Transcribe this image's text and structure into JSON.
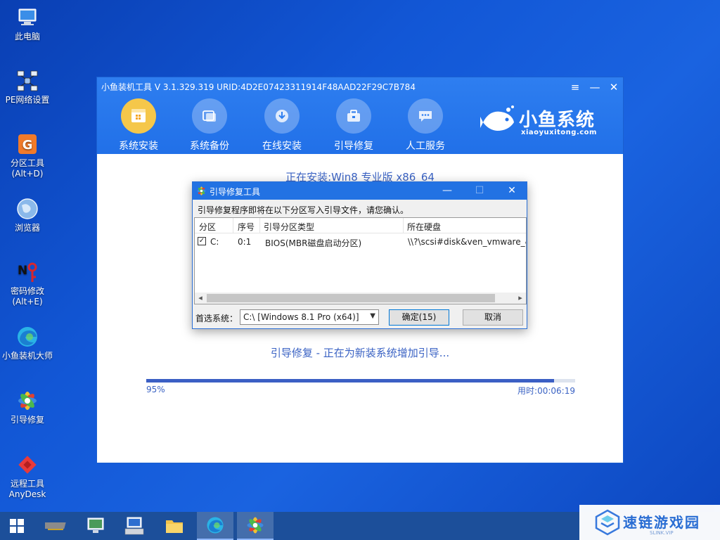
{
  "desktop": {
    "icons": [
      {
        "label": "此电脑",
        "icon": "computer-icon"
      },
      {
        "label": "PE网络设置",
        "icon": "network-icon"
      },
      {
        "label": "分区工具",
        "sub": "(Alt+D)",
        "icon": "partition-icon"
      },
      {
        "label": "浏览器",
        "icon": "browser-icon"
      },
      {
        "label": "密码修改",
        "sub": "(Alt+E)",
        "icon": "password-icon"
      },
      {
        "label": "小鱼装机大师",
        "icon": "edge-icon"
      },
      {
        "label": "引导修复",
        "icon": "boot-repair-icon"
      },
      {
        "label": "远程工具",
        "sub": "AnyDesk",
        "icon": "anydesk-icon"
      }
    ]
  },
  "app": {
    "title": "小鱼装机工具 V 3.1.329.319 URID:4D2E07423311914F48AAD22F29C7B784",
    "nav": [
      {
        "label": "系统安装",
        "icon": "install-icon",
        "active": true
      },
      {
        "label": "系统备份",
        "icon": "backup-icon",
        "active": false
      },
      {
        "label": "在线安装",
        "icon": "download-icon",
        "active": false
      },
      {
        "label": "引导修复",
        "icon": "toolbox-icon",
        "active": false
      },
      {
        "label": "人工服务",
        "icon": "chat-icon",
        "active": false
      }
    ],
    "brand_title": "小鱼系统",
    "brand_sub": "xiaoyuxitong.com",
    "installing": "正在安装:Win8 专业版 x86_64",
    "status": "引导修复 - 正在为新装系统增加引导...",
    "progress_percent": 95,
    "progress_label": "95%",
    "elapsed": "用时:00:06:19"
  },
  "dialog": {
    "title": "引导修复工具",
    "message": "引导修复程序即将在以下分区写入引导文件，请您确认。",
    "columns": [
      "分区",
      "序号",
      "引导分区类型",
      "所在硬盘"
    ],
    "rows": [
      {
        "partition": "C:",
        "index": "0:1",
        "type": "BIOS(MBR磁盘启动分区)",
        "disk": "\\\\?\\scsi#disk&ven_vmware_&",
        "checked": true
      }
    ],
    "pref_label": "首选系统：",
    "pref_value": "C:\\ [Windows 8.1 Pro (x64)]",
    "ok_label": "确定(15)",
    "cancel_label": "取消"
  },
  "watermark": {
    "text": "速链游戏园",
    "sub": "SLINK.VIP"
  },
  "colors": {
    "desktop": "#1257d6",
    "header": "#2170e8",
    "accent_text": "#3b63c4",
    "active_nav": "#f5c74a",
    "taskbar": "#1c4f9a"
  }
}
